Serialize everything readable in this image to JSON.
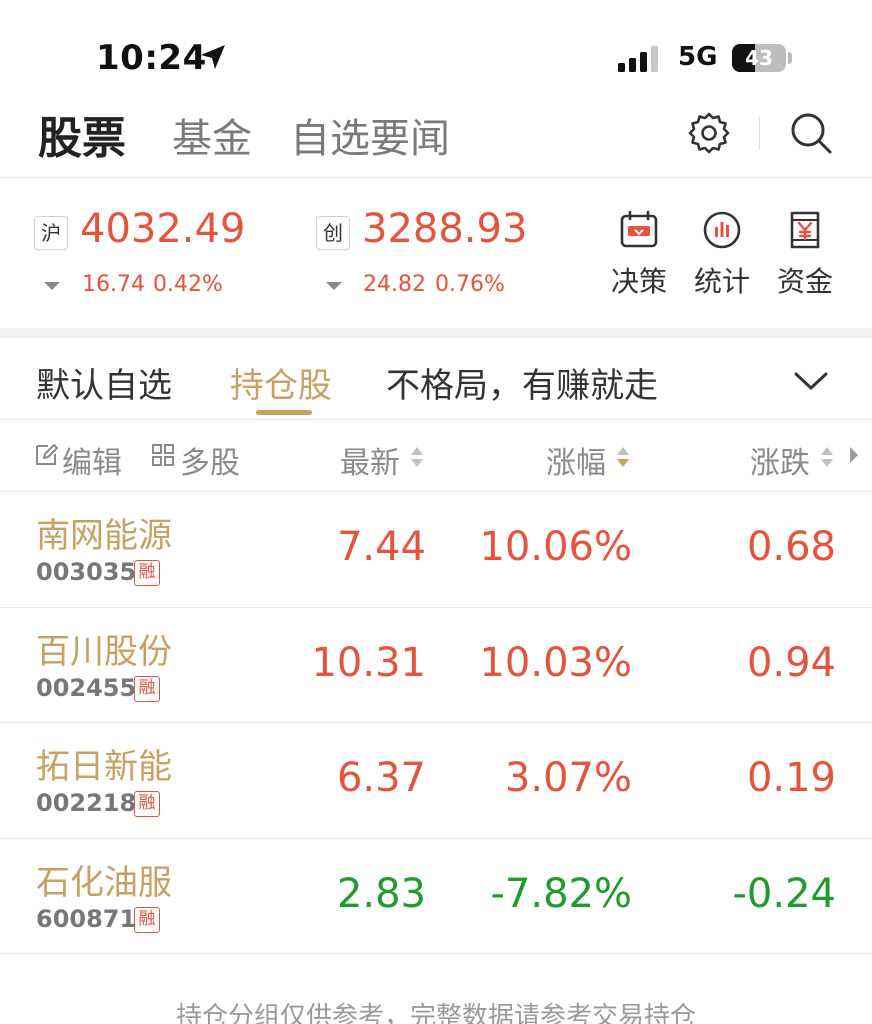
{
  "status_bar": {
    "time": "10:24",
    "network": "5G",
    "battery": "43",
    "battery_level": 0.43
  },
  "top_tabs": {
    "items": [
      {
        "label": "股票",
        "active": true
      },
      {
        "label": "基金",
        "active": false
      },
      {
        "label": "自选要闻",
        "active": false
      }
    ],
    "icons": [
      "gear-icon",
      "search-icon"
    ]
  },
  "indices": [
    {
      "badge": "沪",
      "value": "4032.49",
      "change": "16.74",
      "percent": "0.42%"
    },
    {
      "badge": "创",
      "value": "3288.93",
      "change": "24.82",
      "percent": "0.76%"
    }
  ],
  "quick_actions": [
    {
      "label": "决策",
      "icon": "calendar-decision-icon"
    },
    {
      "label": "统计",
      "icon": "stats-chart-icon"
    },
    {
      "label": "资金",
      "icon": "yuan-funds-icon"
    }
  ],
  "group_tabs": {
    "items": [
      {
        "label": "默认自选",
        "active": false
      },
      {
        "label": "持仓股",
        "active": true
      },
      {
        "label": "不格局，有赚就走",
        "active": false
      }
    ]
  },
  "columns": {
    "edit": "编辑",
    "multi": "多股",
    "latest": "最新",
    "percent": "涨幅",
    "change": "涨跌"
  },
  "stocks": [
    {
      "name": "南网能源",
      "code": "003035",
      "badge": "融",
      "price": "7.44",
      "percent": "10.06%",
      "change": "0.68",
      "direction": "up"
    },
    {
      "name": "百川股份",
      "code": "002455",
      "badge": "融",
      "price": "10.31",
      "percent": "10.03%",
      "change": "0.94",
      "direction": "up"
    },
    {
      "name": "拓日新能",
      "code": "002218",
      "badge": "融",
      "price": "6.37",
      "percent": "3.07%",
      "change": "0.19",
      "direction": "up"
    },
    {
      "name": "石化油服",
      "code": "600871",
      "badge": "融",
      "price": "2.83",
      "percent": "-7.82%",
      "change": "-0.24",
      "direction": "down"
    }
  ],
  "footer_note": "持仓分组仅供参考，完整数据请参考交易持仓",
  "colors": {
    "up": "#e5533c",
    "down": "#1f9a2c",
    "accent": "#c8a062"
  }
}
